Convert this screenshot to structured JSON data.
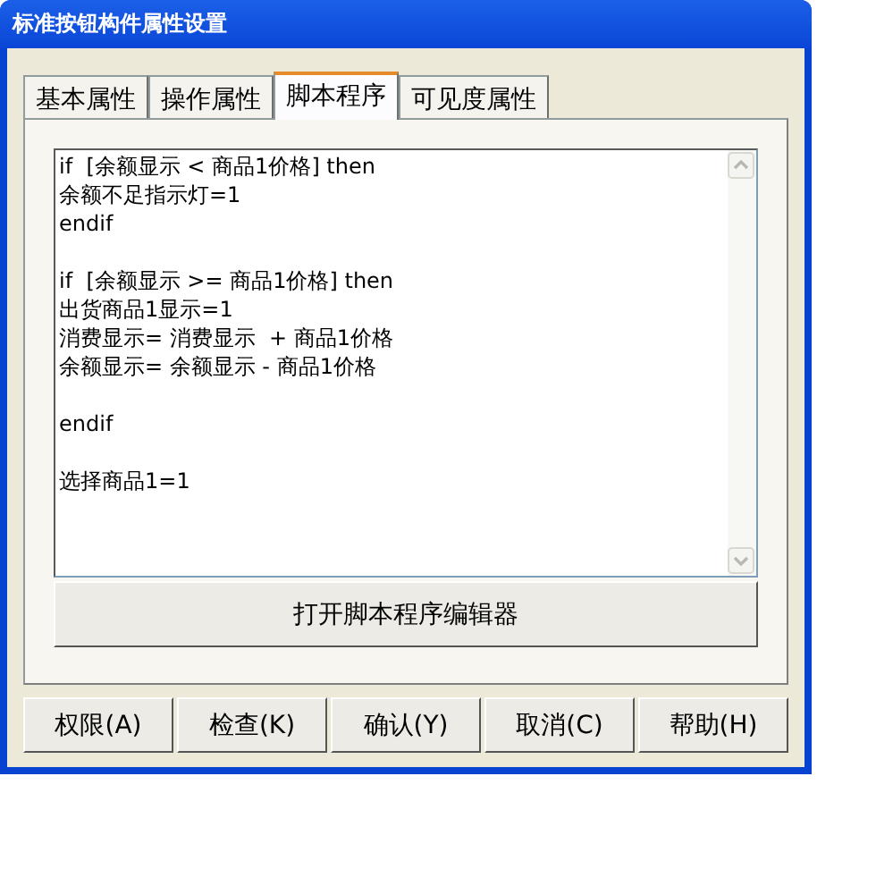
{
  "window": {
    "title": "标准按钮构件属性设置"
  },
  "tabs": [
    {
      "label": "基本属性",
      "selected": false
    },
    {
      "label": "操作属性",
      "selected": false
    },
    {
      "label": "脚本程序",
      "selected": true
    },
    {
      "label": "可见度属性",
      "selected": false
    }
  ],
  "script_editor": {
    "blocks": [
      {
        "lines": [
          "if  [余额显示 < 商品1价格] then",
          "余额不足指示灯=1",
          "endif"
        ]
      },
      {
        "lines": [
          "if  [余额显示 >= 商品1价格] then",
          "出货商品1显示=1",
          "消费显示= 消费显示  + 商品1价格",
          "余额显示= 余额显示 - 商品1价格"
        ]
      },
      {
        "lines": [
          "endif"
        ]
      },
      {
        "lines": [
          "选择商品1=1"
        ]
      }
    ]
  },
  "open_editor_button": "打开脚本程序编辑器",
  "buttons": [
    "权限(A)",
    "检查(K)",
    "确认(Y)",
    "取消(C)",
    "帮助(H)"
  ]
}
